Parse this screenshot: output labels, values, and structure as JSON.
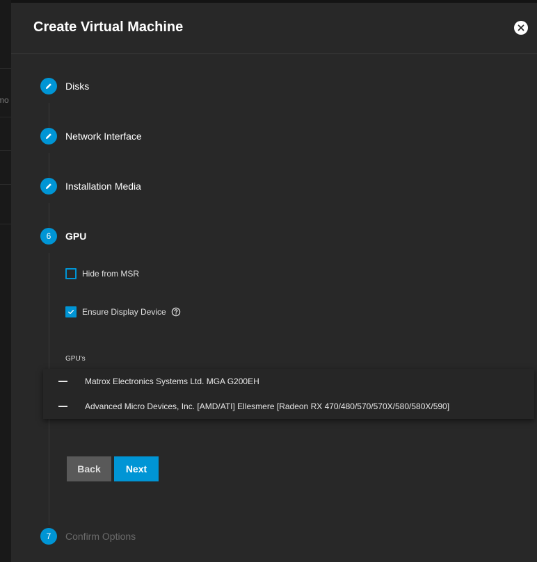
{
  "backdrop": {
    "partial_text": "mo"
  },
  "dialog": {
    "title": "Create Virtual Machine"
  },
  "steps": [
    {
      "label": "Disks",
      "state": "edit",
      "icon": "pencil-icon"
    },
    {
      "label": "Network Interface",
      "state": "edit",
      "icon": "pencil-icon"
    },
    {
      "label": "Installation Media",
      "state": "edit",
      "icon": "pencil-icon"
    },
    {
      "label": "GPU",
      "state": "active",
      "number": "6"
    },
    {
      "label": "Confirm Options",
      "state": "pending",
      "number": "7"
    }
  ],
  "gpu_step": {
    "hide_from_msr": {
      "label": "Hide from MSR",
      "checked": false
    },
    "ensure_display_device": {
      "label": "Ensure Display Device",
      "checked": true,
      "help_icon": "help-circle-icon"
    },
    "gpus_label": "GPU's",
    "gpu_options": [
      "Matrox Electronics Systems Ltd. MGA G200EH",
      "Advanced Micro Devices, Inc. [AMD/ATI] Ellesmere [Radeon RX 470/480/570/570X/580/580X/590]"
    ]
  },
  "buttons": {
    "back": "Back",
    "next": "Next"
  },
  "colors": {
    "accent": "#0095d5",
    "dialog_bg": "#282828",
    "backdrop_bg": "#141414",
    "back_button": "#595959"
  }
}
